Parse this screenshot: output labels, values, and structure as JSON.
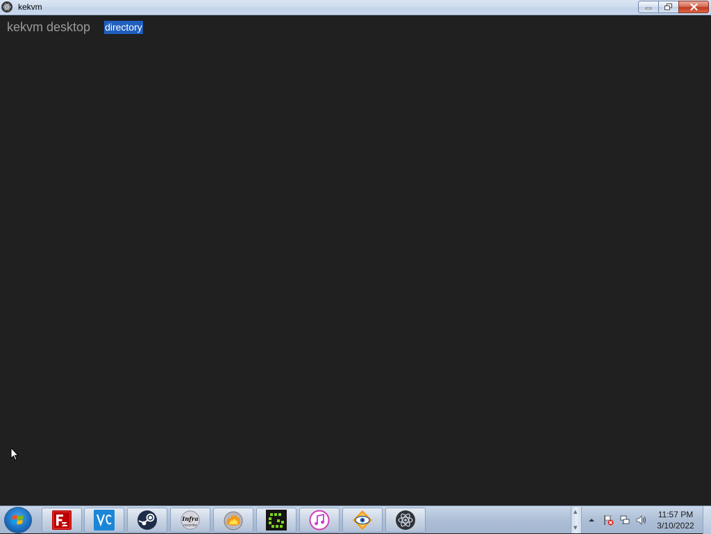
{
  "window": {
    "title": "kekvm",
    "icon": "electron-atom-icon",
    "controls": {
      "minimize": "minimize-icon",
      "maximize": "restore-icon",
      "close": "close-icon"
    }
  },
  "app": {
    "brand": "kekvm desktop",
    "nav": [
      {
        "label": "directory",
        "selected": true
      }
    ]
  },
  "taskbar": {
    "start_icon": "windows-start-orb-icon",
    "pinned": [
      {
        "name": "FileZilla",
        "icon": "filezilla-icon"
      },
      {
        "name": "VNC Viewer",
        "icon": "vnc-viewer-icon"
      },
      {
        "name": "Steam",
        "icon": "steam-icon"
      },
      {
        "name": "InfraRecorder",
        "icon": "infrarecorder-icon"
      },
      {
        "name": "Burn",
        "icon": "flaming-disc-icon"
      },
      {
        "name": "Greenshot",
        "icon": "green-app-icon"
      },
      {
        "name": "iTunes",
        "icon": "itunes-icon"
      },
      {
        "name": "FastStone",
        "icon": "eye-viewer-icon"
      },
      {
        "name": "kekvm",
        "icon": "electron-atom-icon"
      }
    ],
    "tray_icons": [
      "show-hidden-icons-arrow",
      "action-center-flag-icon",
      "network-icon",
      "volume-icon"
    ],
    "clock": {
      "time": "11:57 PM",
      "date": "3/10/2022"
    }
  },
  "colors": {
    "background": "#202020",
    "brand_text": "#9a9a9a",
    "nav_selected_bg": "#1f5fbf"
  }
}
